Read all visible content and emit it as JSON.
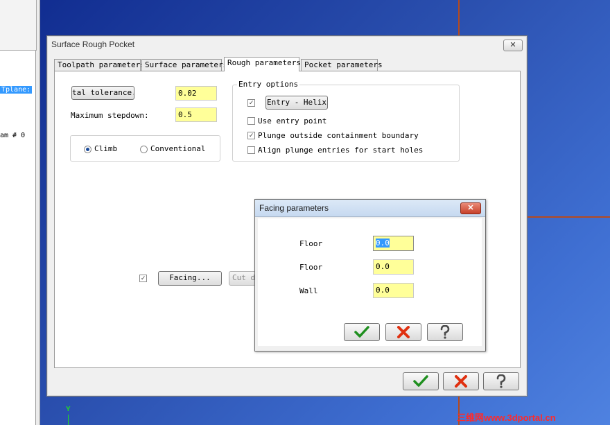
{
  "left_panel": {
    "tplane_text": "Tplane:",
    "item_text": "am # 0"
  },
  "main_dialog": {
    "title": "Surface Rough Pocket",
    "close_label": "✕",
    "tabs": [
      {
        "label": "Toolpath parameters"
      },
      {
        "label": "Surface parameters"
      },
      {
        "label": "Rough parameters"
      },
      {
        "label": "Pocket parameters"
      }
    ],
    "total_tolerance_button": "tal tolerance..",
    "total_tolerance_value": "0.02",
    "max_stepdown_label": "Maximum stepdown:",
    "max_stepdown_value": "0.5",
    "cut_direction": {
      "climb_label": "Climb",
      "conventional_label": "Conventional",
      "selected": "Climb"
    },
    "entry_options": {
      "group_label": "Entry options",
      "entry_button": "Entry - Helix",
      "entry_checked": "✓",
      "use_entry_point_label": "Use entry point",
      "use_entry_point_checked": "",
      "plunge_outside_label": "Plunge outside containment boundary",
      "plunge_outside_checked": "✓",
      "align_plunge_label": "Align plunge entries for start holes",
      "align_plunge_checked": ""
    },
    "facing_checked": "✓",
    "facing_button": "Facing...",
    "cut_depths_button": "Cut de"
  },
  "facing_dialog": {
    "title": "Facing parameters",
    "close_label": "✕",
    "rows": [
      {
        "label": "Floor",
        "value": "0.0"
      },
      {
        "label": "Floor",
        "value": "0.0"
      },
      {
        "label": "Wall",
        "value": "0.0"
      }
    ]
  },
  "viewport": {
    "axis_label": "Y",
    "watermark": "三维网www.3dportal.cn"
  },
  "icons": {
    "ok": "check-icon",
    "cancel": "x-icon",
    "help": "question-icon",
    "ok_color": "#2aa02a",
    "cancel_color": "#e03010",
    "help_color": "#4a4a4a"
  }
}
